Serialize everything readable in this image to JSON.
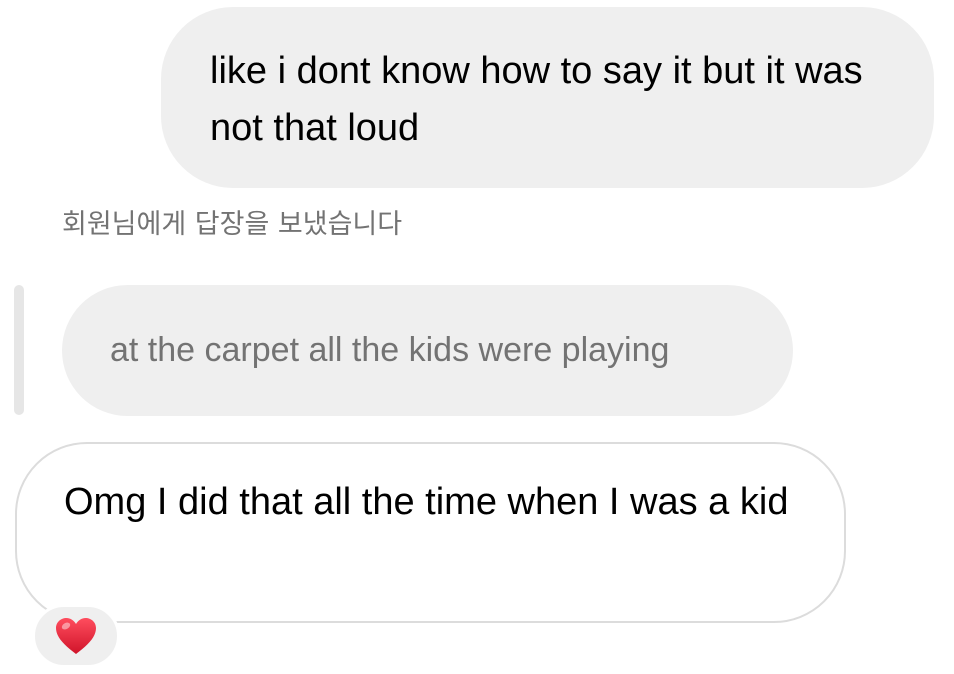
{
  "messages": {
    "sent": {
      "text": "like i dont know how to say it but it was not that loud"
    },
    "reply_caption": "회원님에게 답장을 보냈습니다",
    "quoted": {
      "text": "at the carpet all the kids were playing"
    },
    "received": {
      "text": "Omg I did that all the time when I was a kid",
      "reaction": {
        "icon": "heart-icon",
        "color": "#e8253a"
      }
    }
  },
  "colors": {
    "bubble_gray": "#efefef",
    "secondary_text": "#737373",
    "border": "#dcdcdc"
  }
}
